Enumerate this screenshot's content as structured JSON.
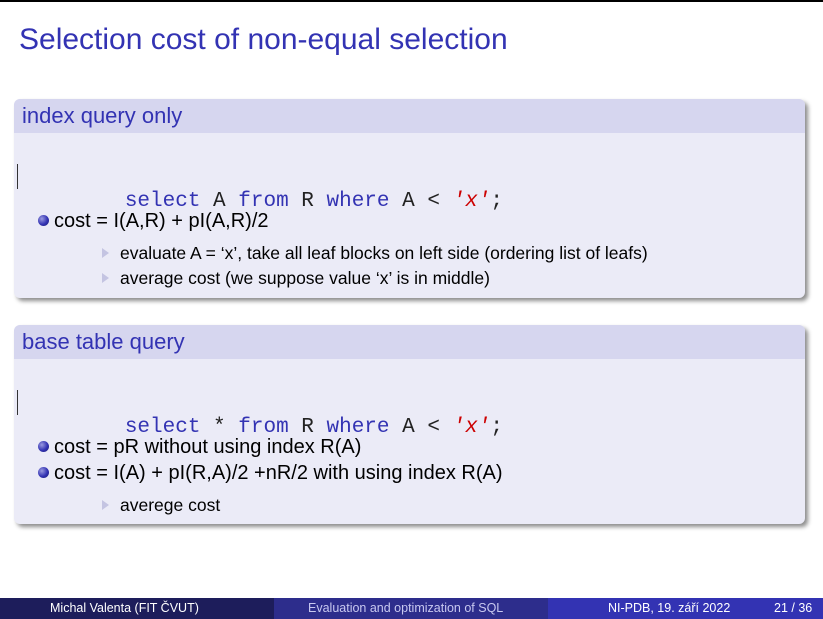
{
  "title": "Selection cost of non-equal selection",
  "block1": {
    "header": "index query only",
    "code": {
      "kw1": "select",
      "t1": " A ",
      "kw2": "from",
      "t2": " R ",
      "kw3": "where",
      "t3": " A < ",
      "str": "'x'",
      "end": ";"
    },
    "bullet1": "cost = I(A,R) + pI(A,R)/2",
    "sub1": "evaluate A = ‘x’, take all leaf blocks on left side (ordering list of leafs)",
    "sub2": "average cost (we suppose value ‘x’ is in middle)"
  },
  "block2": {
    "header": "base table query",
    "code": {
      "kw1": "select",
      "t1": " * ",
      "kw2": "from",
      "t2": " R ",
      "kw3": "where",
      "t3": " A < ",
      "str": "'x'",
      "end": ";"
    },
    "bullet1": "cost = pR without using index R(A)",
    "bullet2": "cost = I(A) + pI(R,A)/2 +nR/2 with using index R(A)",
    "sub1": "averege cost"
  },
  "footer": {
    "author": "Michal Valenta  (FIT ČVUT)",
    "talk": "Evaluation and optimization of SQL",
    "course_date": "NI-PDB, 19. září 2022",
    "page": "21 / 36"
  },
  "colors": {
    "title": "#3333b3",
    "block_header_bg": "#d6d6ef",
    "block_body_bg": "#ebebf7",
    "string_literal": "#cc0000",
    "footer_dark": "#1d1d5b",
    "footer_mid": "#2d2d8c",
    "footer_light": "#3333b3"
  }
}
